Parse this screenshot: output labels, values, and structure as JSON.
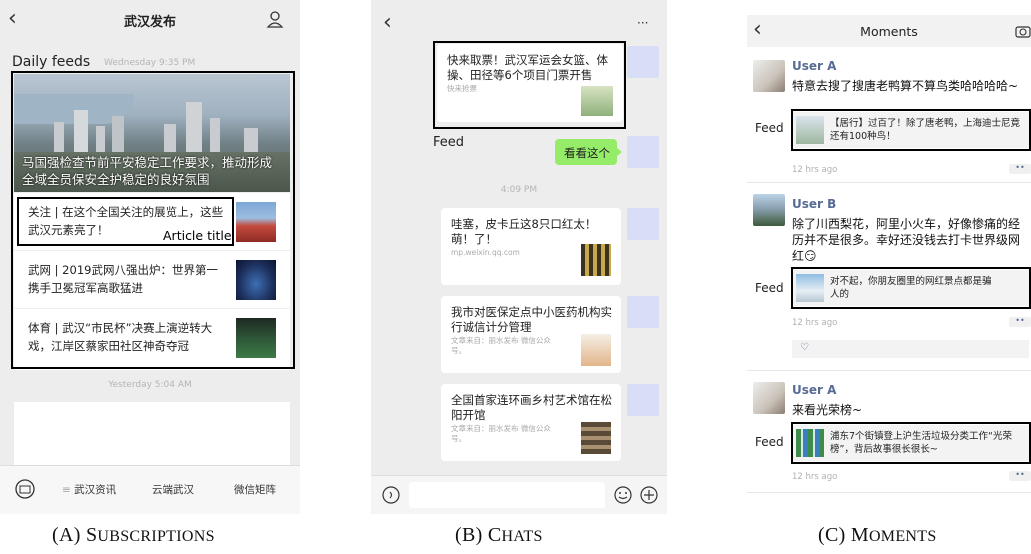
{
  "subscriptions": {
    "title": "武汉发布",
    "section_label": "Daily feeds",
    "time_1": "Wednesday 9:35 PM",
    "headline": "马国强检查节前平安稳定工作要求，推动形成全域全员保安全护稳定的良好氛围",
    "articles": [
      {
        "text": "关注 | 在这个全国关注的展览上，这些武汉元素亮了！"
      },
      {
        "text": "武网 | 2019武网八强出炉：世界第一携手卫冕冠军高歌猛进"
      },
      {
        "text": "体育 | 武汉“市民杯”决赛上演逆转大戏，江岸区蔡家田社区神奇夺冠"
      }
    ],
    "article_title_label": "Article title",
    "time_2": "Yesterday 5:04 AM",
    "menu": [
      "武汉资讯",
      "云端武汉",
      "微信矩阵"
    ],
    "caption": {
      "letter": "(A) S",
      "rest": "UBSCRIPTIONS"
    }
  },
  "chats": {
    "more_label": "···",
    "feed_label": "Feed",
    "messages": [
      {
        "title": "快来取票！武汉军运会女篮、体操、田径等6个项目门票开售",
        "source": "快来抢票"
      },
      {
        "title": "哇塞，皮卡丘这8只口红太！萌！了！",
        "source": "mp.weixin.qq.com"
      },
      {
        "title": "我市对医保定点中小医药机构实行诚信计分管理",
        "source": "文章来自：丽水发布 微信公众号。"
      },
      {
        "title": "全国首家连环画乡村艺术馆在松阳开馆",
        "source": "文章来自：丽水发布 微信公众号。"
      }
    ],
    "green_bubble": "看看这个",
    "time": "4:09 PM",
    "caption": {
      "letter": "(B) C",
      "rest": "HATS"
    }
  },
  "moments": {
    "title": "Moments",
    "feed_label": "Feed",
    "posts": [
      {
        "user": "User A",
        "text": "特意去搜了搜唐老鸭算不算鸟类哈哈哈哈~",
        "shared": "【居行】过百了！除了唐老鸭，上海迪士尼竟还有100种鸟！",
        "time": "12 hrs ago"
      },
      {
        "user": "User B",
        "text": "除了川西梨花，阿里小火车，好像惨痛的经历并不是很多。幸好还没钱去打卡世界级网红😏",
        "shared": "对不起，你朋友圈里的网红景点都是骗人的",
        "time": "12 hrs ago"
      },
      {
        "user": "User A",
        "text": "来看光荣榜~",
        "shared": "浦东7个街镇登上沪生活垃圾分类工作“光荣榜”，背后故事很长很长~",
        "time": "12 hrs ago"
      }
    ],
    "caption": {
      "letter": "(C) M",
      "rest": "OMENTS"
    }
  }
}
